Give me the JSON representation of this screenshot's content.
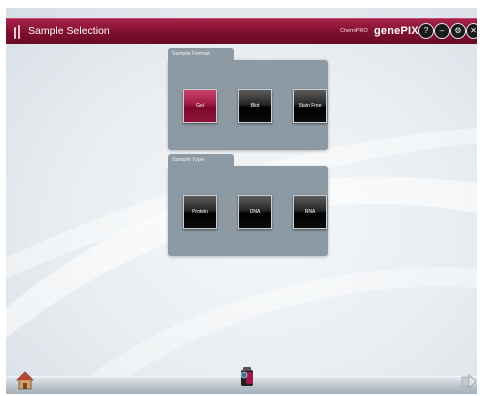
{
  "window": {
    "title": "Sample Selection",
    "brand_small": "ChemiPRO",
    "brand_big": "genePIX"
  },
  "title_buttons": [
    {
      "name": "help-button",
      "icon": "question-icon",
      "glyph": "?"
    },
    {
      "name": "minimize-button",
      "icon": "minus-icon",
      "glyph": "–"
    },
    {
      "name": "settings-button",
      "icon": "gear-icon",
      "glyph": "⚙"
    },
    {
      "name": "close-button",
      "icon": "close-icon",
      "glyph": "✕"
    }
  ],
  "sample_format": {
    "label": "Sample Format",
    "options": [
      "Gel",
      "Blot",
      "Stain Free"
    ],
    "selected": "Gel"
  },
  "sample_type": {
    "label": "Sample Type",
    "options": [
      "Protein",
      "DNA",
      "RNA"
    ],
    "selected": null
  },
  "colors": {
    "accent": "#8b1538",
    "panel": "#8d9aa3",
    "button_dark": "#000000"
  },
  "bottom_bar": {
    "left_icon": "home-icon",
    "center_icon": "camera-icon",
    "right_icon": "next-arrow-icon"
  }
}
